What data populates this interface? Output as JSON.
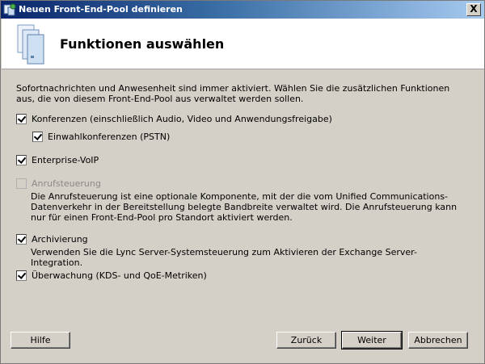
{
  "window": {
    "title": "Neuen Front-End-Pool definieren",
    "close_glyph": "X"
  },
  "header": {
    "title": "Funktionen auswählen"
  },
  "intro": "Sofortnachrichten und Anwesenheit sind immer aktiviert. Wählen Sie die zusätzlichen Funktionen aus, die von diesem Front-End-Pool aus verwaltet werden sollen.",
  "options": {
    "conferencing": {
      "label": "Konferenzen (einschließlich Audio, Video und Anwendungsfreigabe)",
      "checked": true
    },
    "dialin": {
      "label": "Einwahlkonferenzen (PSTN)",
      "checked": true
    },
    "voip": {
      "label": "Enterprise-VoIP",
      "checked": true
    },
    "call_admission": {
      "label": "Anrufsteuerung",
      "checked": false,
      "disabled": true,
      "description": "Die Anrufsteuerung ist eine optionale Komponente, mit der die vom Unified Communications-Datenverkehr in der Bereitstellung belegte Bandbreite verwaltet wird. Die Anrufsteuerung kann nur für einen Front-End-Pool pro Standort aktiviert werden."
    },
    "archiving": {
      "label": "Archivierung",
      "checked": true,
      "description": "Verwenden Sie die Lync Server-Systemsteuerung zum Aktivieren der Exchange Server-Integration."
    },
    "monitoring": {
      "label": "Überwachung (KDS- und QoE-Metriken)",
      "checked": true
    }
  },
  "buttons": {
    "help": "Hilfe",
    "back": "Zurück",
    "next": "Weiter",
    "cancel": "Abbrechen"
  }
}
